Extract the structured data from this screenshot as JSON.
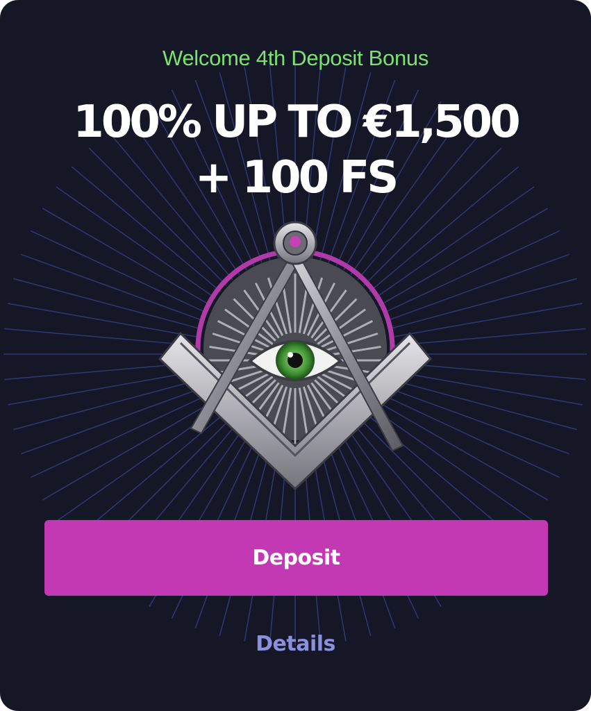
{
  "promo": {
    "subtitle": "Welcome 4th Deposit Bonus",
    "headline_line1": "100% UP TO €1,500",
    "headline_line2": "+ 100 FS",
    "emblem_icon": "masonic-square-compass-eye-icon"
  },
  "actions": {
    "deposit_label": "Deposit",
    "details_label": "Details"
  },
  "colors": {
    "background": "#151726",
    "subtitle": "#79e36d",
    "button": "#c239b3",
    "details": "#8a8fde",
    "rays": "#3a3f8a"
  }
}
